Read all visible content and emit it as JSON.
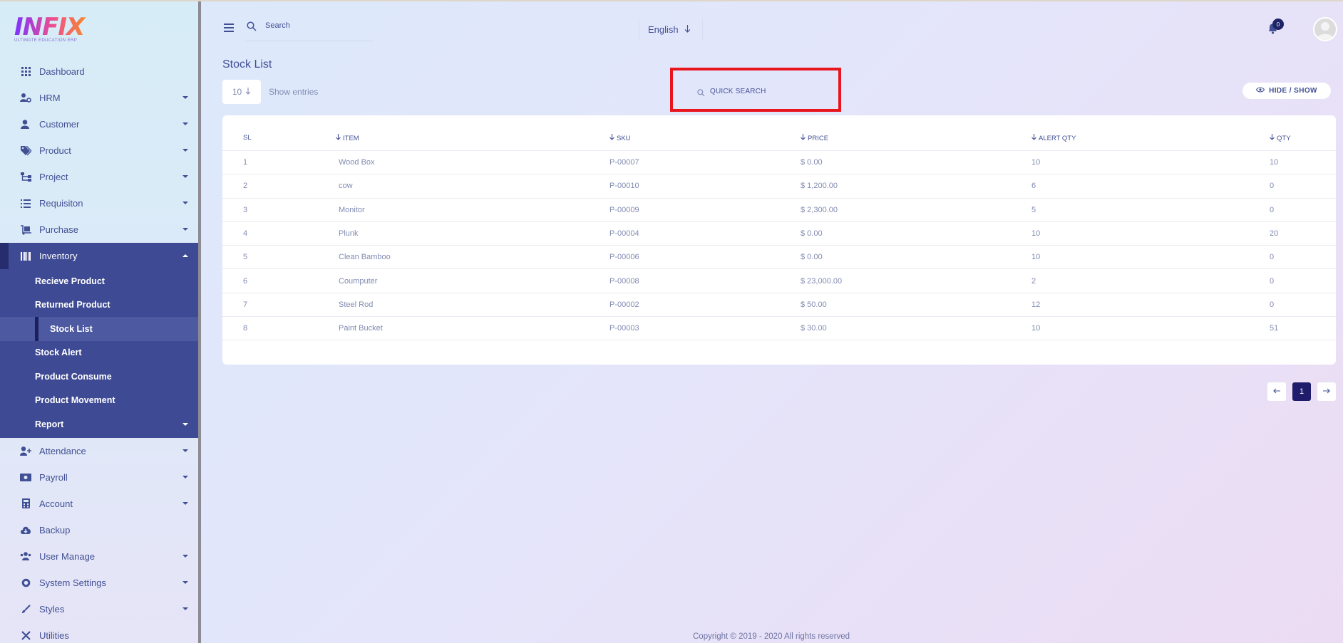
{
  "brand": {
    "logo_text": "INFIX",
    "tagline": "ULTIMATE EDUCATION ERP"
  },
  "sidebar": {
    "items": [
      {
        "label": "Dashboard",
        "icon": "grid-icon",
        "caret": false
      },
      {
        "label": "HRM",
        "icon": "users-cog-icon",
        "caret": true
      },
      {
        "label": "Customer",
        "icon": "user-icon",
        "caret": true
      },
      {
        "label": "Product",
        "icon": "tags-icon",
        "caret": true
      },
      {
        "label": "Project",
        "icon": "sitemap-icon",
        "caret": true
      },
      {
        "label": "Requisiton",
        "icon": "list-icon",
        "caret": true
      },
      {
        "label": "Purchase",
        "icon": "dolly-icon",
        "caret": true
      },
      {
        "label": "Inventory",
        "icon": "barcode-icon",
        "caret": true,
        "expanded": true
      },
      {
        "label": "Attendance",
        "icon": "user-plus-icon",
        "caret": true
      },
      {
        "label": "Payroll",
        "icon": "money-icon",
        "caret": true
      },
      {
        "label": "Account",
        "icon": "calculator-icon",
        "caret": true
      },
      {
        "label": "Backup",
        "icon": "cloud-download-icon",
        "caret": false
      },
      {
        "label": "User Manage",
        "icon": "users-icon",
        "caret": true
      },
      {
        "label": "System Settings",
        "icon": "cog-icon",
        "caret": true
      },
      {
        "label": "Styles",
        "icon": "brush-icon",
        "caret": true
      },
      {
        "label": "Utilities",
        "icon": "tools-icon",
        "caret": false
      }
    ],
    "inventory_sub": [
      {
        "label": "Recieve Product"
      },
      {
        "label": "Returned Product"
      },
      {
        "label": "Stock List",
        "active": true
      },
      {
        "label": "Stock Alert"
      },
      {
        "label": "Product Consume"
      },
      {
        "label": "Product Movement"
      },
      {
        "label": "Report",
        "caret": true
      }
    ]
  },
  "header": {
    "search_placeholder": "Search",
    "language": "English",
    "notification_count": "0"
  },
  "main": {
    "title": "Stock List",
    "entries_value": "10",
    "entries_label": "Show entries",
    "quick_search_label": "QUICK SEARCH",
    "hide_show_label": "HIDE / SHOW"
  },
  "table": {
    "columns": [
      "SL",
      "ITEM",
      "SKU",
      "PRICE",
      "ALERT QTY",
      "QTY"
    ],
    "rows": [
      [
        "1",
        "Wood Box",
        "P-00007",
        "$ 0.00",
        "10",
        "10"
      ],
      [
        "2",
        "cow",
        "P-00010",
        "$ 1,200.00",
        "6",
        "0"
      ],
      [
        "3",
        "Monitor",
        "P-00009",
        "$ 2,300.00",
        "5",
        "0"
      ],
      [
        "4",
        "Plunk",
        "P-00004",
        "$ 0.00",
        "10",
        "20"
      ],
      [
        "5",
        "Clean Bamboo",
        "P-00006",
        "$ 0.00",
        "10",
        "0"
      ],
      [
        "6",
        "Coumputer",
        "P-00008",
        "$ 23,000.00",
        "2",
        "0"
      ],
      [
        "7",
        "Steel Rod",
        "P-00002",
        "$ 50.00",
        "12",
        "0"
      ],
      [
        "8",
        "Paint Bucket",
        "P-00003",
        "$ 30.00",
        "10",
        "51"
      ]
    ]
  },
  "pagination": {
    "current": "1"
  },
  "footer": {
    "copyright": "Copyright © 2019 - 2020 All rights reserved"
  },
  "colors": {
    "accent": "#415094",
    "active_nav": "#3e4a93",
    "highlight_box": "#e8151d"
  }
}
